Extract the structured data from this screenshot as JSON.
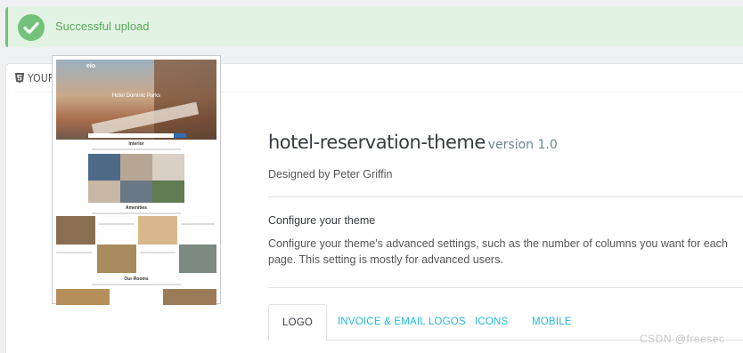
{
  "alert": {
    "message": "Successful upload",
    "icon": "check-circle-icon",
    "color": "#72c279"
  },
  "panel": {
    "heading": "YOUR CURRENT THEME",
    "heading_icon": "html5-icon"
  },
  "preview": {
    "logo": "eio",
    "hotel_name": "Hotel Dominic Parks",
    "sections": [
      "Interior",
      "Amenities",
      "Our Rooms"
    ]
  },
  "theme": {
    "name": "hotel-reservation-theme",
    "version": "version 1.0",
    "designed_by": "Designed by Peter Griffin"
  },
  "configure": {
    "title": "Configure your theme",
    "description": "Configure your theme's advanced settings, such as the number of columns you want for each page. This setting is mostly for advanced users."
  },
  "tabs": [
    {
      "label": "LOGO",
      "active": true
    },
    {
      "label": "INVOICE & EMAIL LOGOS",
      "active": false
    },
    {
      "label": "ICONS",
      "active": false
    },
    {
      "label": "MOBILE",
      "active": false
    }
  ],
  "watermark": "CSDN @freesec",
  "colors": {
    "accent": "#25b9d7",
    "success": "#72c279",
    "text": "#363a41"
  }
}
